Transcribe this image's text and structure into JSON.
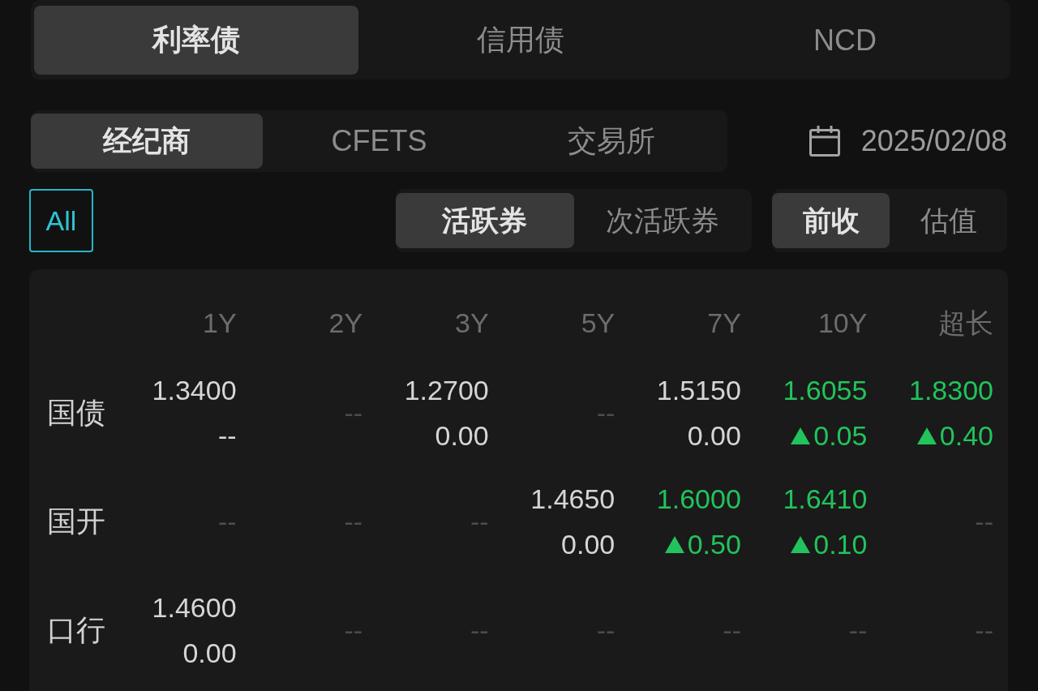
{
  "bond_type_tabs": [
    {
      "label": "利率债",
      "selected": true
    },
    {
      "label": "信用债",
      "selected": false
    },
    {
      "label": "NCD",
      "selected": false
    }
  ],
  "source_tabs": [
    {
      "label": "经纪商",
      "selected": true
    },
    {
      "label": "CFETS",
      "selected": false
    },
    {
      "label": "交易所",
      "selected": false
    }
  ],
  "date": "2025/02/08",
  "all_filter": {
    "label": "All",
    "selected": true
  },
  "liquidity_tabs": [
    {
      "label": "活跃券",
      "selected": true
    },
    {
      "label": "次活跃券",
      "selected": false
    }
  ],
  "price_tabs": [
    {
      "label": "前收",
      "selected": true
    },
    {
      "label": "估值",
      "selected": false
    }
  ],
  "table": {
    "columns": [
      "1Y",
      "2Y",
      "3Y",
      "5Y",
      "7Y",
      "10Y",
      "超长"
    ],
    "rows": [
      {
        "label": "国债",
        "cells": [
          {
            "kind": "quote",
            "yield": "1.3400",
            "change": "--",
            "rising": false
          },
          {
            "kind": "empty",
            "text": "--"
          },
          {
            "kind": "quote",
            "yield": "1.2700",
            "change": "0.00",
            "rising": false
          },
          {
            "kind": "empty",
            "text": "--"
          },
          {
            "kind": "quote",
            "yield": "1.5150",
            "change": "0.00",
            "rising": false
          },
          {
            "kind": "quote",
            "yield": "1.6055",
            "change": "0.05",
            "rising": true
          },
          {
            "kind": "quote",
            "yield": "1.8300",
            "change": "0.40",
            "rising": true
          }
        ]
      },
      {
        "label": "国开",
        "cells": [
          {
            "kind": "empty",
            "text": "--"
          },
          {
            "kind": "empty",
            "text": "--"
          },
          {
            "kind": "empty",
            "text": "--"
          },
          {
            "kind": "quote",
            "yield": "1.4650",
            "change": "0.00",
            "rising": false
          },
          {
            "kind": "quote",
            "yield": "1.6000",
            "change": "0.50",
            "rising": true
          },
          {
            "kind": "quote",
            "yield": "1.6410",
            "change": "0.10",
            "rising": true
          },
          {
            "kind": "empty",
            "text": "--"
          }
        ]
      },
      {
        "label": "口行",
        "cells": [
          {
            "kind": "quote",
            "yield": "1.4600",
            "change": "0.00",
            "rising": false
          },
          {
            "kind": "empty",
            "text": "--"
          },
          {
            "kind": "empty",
            "text": "--"
          },
          {
            "kind": "empty",
            "text": "--"
          },
          {
            "kind": "empty",
            "text": "--"
          },
          {
            "kind": "empty",
            "text": "--"
          },
          {
            "kind": "empty",
            "text": "--"
          }
        ]
      }
    ]
  }
}
